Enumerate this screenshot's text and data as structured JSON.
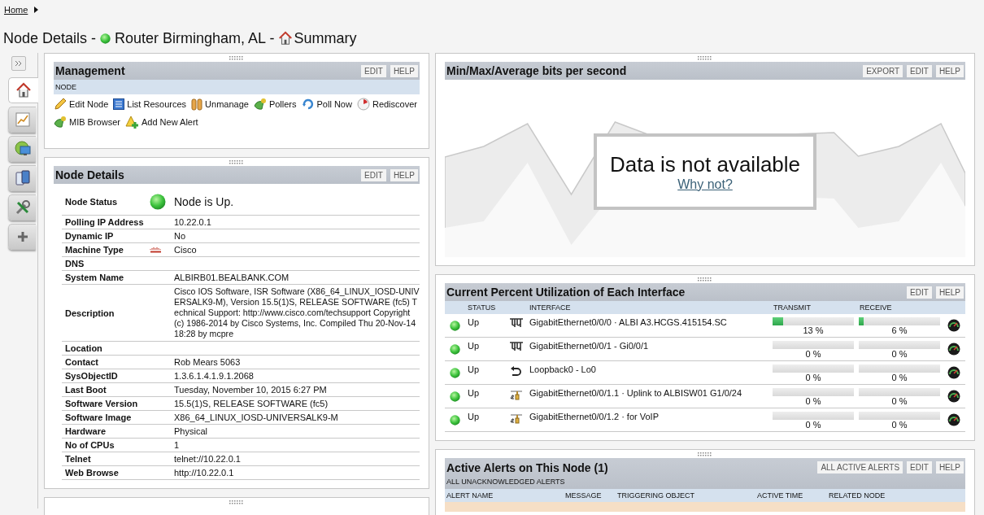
{
  "breadcrumb": {
    "home": "Home"
  },
  "title": {
    "prefix": "Node Details -",
    "node": "Router Birmingham, AL -",
    "view": "Summary"
  },
  "sidebar": {
    "tabs": [
      {
        "kind": "summary",
        "selected": true
      },
      {
        "kind": "charts",
        "selected": false
      },
      {
        "kind": "network",
        "selected": false
      },
      {
        "kind": "device",
        "selected": false
      },
      {
        "kind": "tools",
        "selected": false
      },
      {
        "kind": "add",
        "selected": false
      }
    ]
  },
  "management": {
    "title": "Management",
    "buttons": [
      "EDIT",
      "HELP"
    ],
    "section": "NODE",
    "actions": [
      {
        "kind": "edit",
        "label": "Edit Node"
      },
      {
        "kind": "list",
        "label": "List Resources"
      },
      {
        "kind": "unmanage",
        "label": "Unmanage"
      },
      {
        "kind": "pollers",
        "label": "Pollers"
      },
      {
        "kind": "poll",
        "label": "Poll Now"
      },
      {
        "kind": "rediscover",
        "label": "Rediscover"
      },
      {
        "kind": "pollers",
        "label": "MIB Browser"
      },
      {
        "kind": "alert",
        "label": "Add New Alert"
      }
    ]
  },
  "node_details": {
    "title": "Node Details",
    "buttons": [
      "EDIT",
      "HELP"
    ],
    "rows": [
      {
        "kind": "status",
        "label": "Node Status",
        "value": "Node is Up."
      },
      {
        "kind": "text",
        "label": "Polling IP Address",
        "value": "10.22.0.1"
      },
      {
        "kind": "text",
        "label": "Dynamic IP",
        "value": "No"
      },
      {
        "kind": "vendor",
        "label": "Machine Type",
        "value": "Cisco"
      },
      {
        "kind": "text",
        "label": "DNS"
      },
      {
        "kind": "text",
        "label": "System Name",
        "value": "ALBIRB01.BEALBANK.COM"
      },
      {
        "kind": "long",
        "label": "Description",
        "value": "Cisco IOS Software, ISR Software (X86_64_LINUX_IOSD-UNIVERSALK9-M), Version 15.5(1)S, RELEASE SOFTWARE (fc5) Technical Support: http://www.cisco.com/techsupport Copyright (c) 1986-2014 by Cisco Systems, Inc. Compiled Thu 20-Nov-14 18:28 by mcpre"
      },
      {
        "kind": "text",
        "label": "Location"
      },
      {
        "kind": "text",
        "label": "Contact",
        "value": "Rob Mears 5063"
      },
      {
        "kind": "text",
        "label": "SysObjectID",
        "value": "1.3.6.1.4.1.9.1.2068"
      },
      {
        "kind": "text",
        "label": "Last Boot",
        "value": "Tuesday, November 10, 2015 6:27 PM"
      },
      {
        "kind": "text",
        "label": "Software Version",
        "value": "15.5(1)S, RELEASE SOFTWARE (fc5)"
      },
      {
        "kind": "text",
        "label": "Software Image",
        "value": "X86_64_LINUX_IOSD-UNIVERSALK9-M"
      },
      {
        "kind": "text",
        "label": "Hardware",
        "value": "Physical"
      },
      {
        "kind": "text",
        "label": "No of CPUs",
        "value": "1"
      },
      {
        "kind": "text",
        "label": "Telnet",
        "value": "telnet://10.22.0.1"
      },
      {
        "kind": "text",
        "label": "Web Browse",
        "value": "http://10.22.0.1"
      }
    ]
  },
  "chart_panel": {
    "title": "Min/Max/Average bits per second",
    "buttons": [
      "EXPORT",
      "EDIT",
      "HELP"
    ],
    "message": "Data is not available",
    "link": "Why not?"
  },
  "utilization": {
    "title": "Current Percent Utilization of Each Interface",
    "buttons": [
      "EDIT",
      "HELP"
    ],
    "columns": [
      "STATUS",
      "INTERFACE",
      "TRANSMIT",
      "RECEIVE"
    ],
    "rows": [
      {
        "status": "Up",
        "kind": "ethernet",
        "interface": "GigabitEthernet0/0/0 · ALBI A3.HCGS.415154.SC",
        "transmit": {
          "level": 0.13,
          "reading": "13 %"
        },
        "receive": {
          "level": 0.06,
          "reading": "6 %"
        }
      },
      {
        "status": "Up",
        "kind": "ethernet",
        "interface": "GigabitEthernet0/0/1 - Gi0/0/1",
        "transmit": {
          "level": 0,
          "reading": "0 %"
        },
        "receive": {
          "level": 0,
          "reading": "0 %"
        }
      },
      {
        "status": "Up",
        "kind": "loopback",
        "interface": "Loopback0 - Lo0",
        "transmit": {
          "level": 0,
          "reading": "0 %"
        },
        "receive": {
          "level": 0,
          "reading": "0 %"
        }
      },
      {
        "status": "Up",
        "kind": "vlan",
        "interface": "GigabitEthernet0/0/1.1 · Uplink to ALBISW01 G1/0/24",
        "transmit": {
          "level": 0,
          "reading": "0 %"
        },
        "receive": {
          "level": 0,
          "reading": "0 %"
        }
      },
      {
        "status": "Up",
        "kind": "vlan",
        "interface": "GigabitEthernet0/0/1.2 · for VoIP",
        "transmit": {
          "level": 0,
          "reading": "0 %"
        },
        "receive": {
          "level": 0,
          "reading": "0 %"
        }
      }
    ]
  },
  "alerts": {
    "title": "Active Alerts on This Node (1)",
    "buttons": [
      "ALL ACTIVE ALERTS",
      "EDIT",
      "HELP"
    ],
    "subtitle": "ALL UNACKNOWLEDGED ALERTS",
    "columns": [
      "ALERT NAME",
      "MESSAGE",
      "TRIGGERING OBJECT",
      "ACTIVE TIME",
      "RELATED NODE"
    ]
  }
}
